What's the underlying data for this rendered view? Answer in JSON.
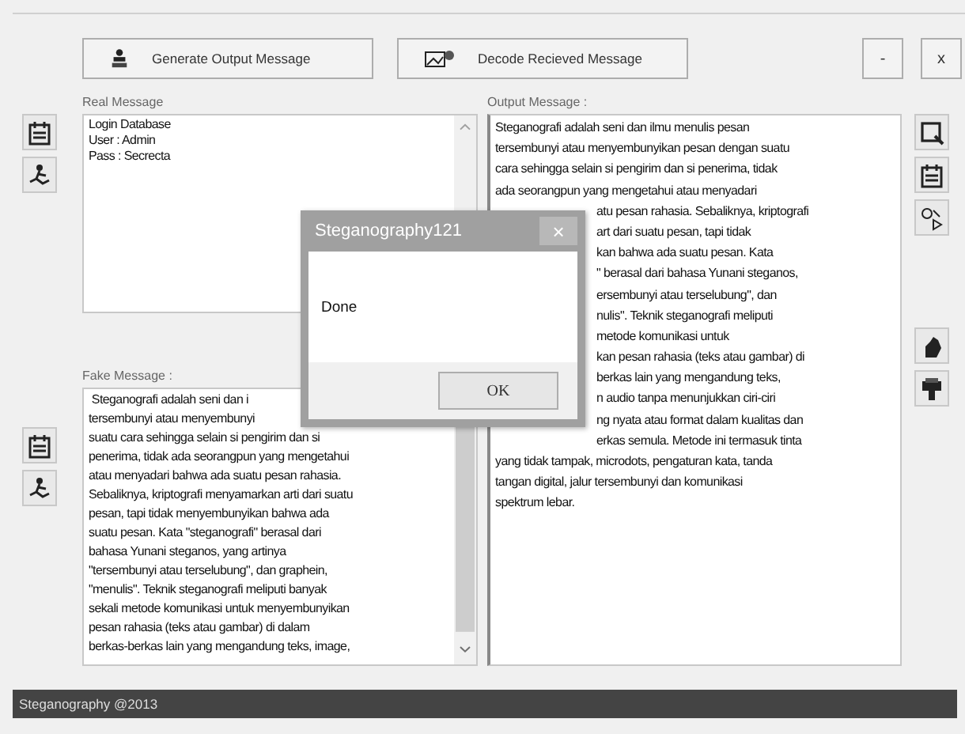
{
  "toolbar": {
    "buttons": [
      {
        "kind": "generate",
        "label": "Generate Output Message"
      },
      {
        "kind": "decode",
        "label": "Decode Recieved Message"
      }
    ],
    "window_buttons": [
      "-",
      "x"
    ]
  },
  "real_message": {
    "label": "Real Message",
    "lines": [
      "Login Database",
      "User : Admin",
      "Pass : Secrecta"
    ]
  },
  "fake_message": {
    "label": "Fake Message :",
    "lines": [
      {
        "text": " Steganografi adalah seni dan i"
      },
      {
        "text": "tersembunyi atau menyembunyi"
      },
      {
        "text": "suatu cara sehingga selain si pengirim dan si"
      },
      {
        "text": "penerima, tidak ada seorangpun yang mengetahui"
      },
      {
        "text": "atau menyadari bahwa ada suatu pesan rahasia."
      },
      {
        "text": "Sebaliknya, kriptografi menyamarkan arti dari suatu"
      },
      {
        "text": "pesan, tapi tidak menyembunyikan bahwa ada"
      },
      {
        "text": "suatu pesan. Kata \"steganografi\" berasal dari"
      },
      {
        "text": "bahasa Yunani steganos, yang artinya"
      },
      {
        "text": "\"tersembunyi atau terselubung\", dan graphein,"
      },
      {
        "text": "\"menulis\". Teknik steganografi meliputi banyak"
      },
      {
        "text": "sekali metode komunikasi untuk menyembunyikan"
      },
      {
        "text": "pesan rahasia (teks atau gambar) di dalam"
      },
      {
        "text": "berkas-berkas lain yang mengandung teks, image,"
      }
    ]
  },
  "output_message": {
    "label": "Output Message :",
    "lines": [
      {
        "text": "Steganografi adalah seni dan ilmu menulis pesan",
        "covered": false
      },
      {
        "text": "tersembunyi atau menyembunyikan pesan dengan suatu",
        "covered": false
      },
      {
        "text": "cara sehingga selain si pengirim dan si penerima, tidak",
        "covered": false
      },
      {
        "text": "ada seorangpun yang mengetahui atau menyadari",
        "covered": false
      },
      {
        "text": "atu pesan rahasia. Sebaliknya, kriptografi",
        "covered": true
      },
      {
        "text": "art dari suatu pesan, tapi tidak",
        "covered": true
      },
      {
        "text": "kan bahwa ada suatu pesan. Kata",
        "covered": true
      },
      {
        "text": "\" berasal dari bahasa Yunani steganos,",
        "covered": true
      },
      {
        "text": "ersembunyi atau terselubung\", dan",
        "covered": true
      },
      {
        "text": "nulis\". Teknik steganografi meliputi",
        "covered": true
      },
      {
        "text": "metode komunikasi untuk",
        "covered": true
      },
      {
        "text": "kan pesan rahasia (teks atau gambar) di",
        "covered": true
      },
      {
        "text": "berkas lain yang mengandung teks,",
        "covered": true
      },
      {
        "text": "n audio tanpa menunjukkan ciri-ciri",
        "covered": true
      },
      {
        "text": "ng nyata atau format dalam kualitas dan",
        "covered": true
      },
      {
        "text": "erkas semula. Metode ini termasuk tinta",
        "covered": true
      },
      {
        "text": "yang tidak tampak, microdots, pengaturan kata, tanda",
        "covered": false
      },
      {
        "text": "tangan digital, jalur tersembunyi dan komunikasi",
        "covered": false
      },
      {
        "text": "spektrum lebar.",
        "covered": false
      }
    ]
  },
  "status_bar": {
    "text": "Steganography @2013"
  },
  "dialog": {
    "title": "Steganography121",
    "close": "×",
    "message": "Done",
    "button": "OK"
  }
}
